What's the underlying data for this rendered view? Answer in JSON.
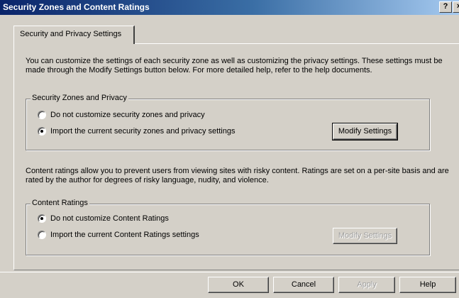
{
  "window": {
    "title": "Security Zones and Content Ratings",
    "help_label": "?",
    "close_label": "×"
  },
  "tab": {
    "label": "Security and Privacy Settings"
  },
  "intro_text": "You can customize the settings of each security zone as well as customizing the privacy settings. These settings must be made through the Modify Settings button below. For more detailed help, refer to the help documents.",
  "security_group": {
    "legend": "Security Zones and Privacy",
    "options": [
      {
        "label": "Do not customize security zones and privacy",
        "selected": false
      },
      {
        "label": "Import the current security zones and privacy settings",
        "selected": true
      }
    ],
    "modify_label": "Modify Settings"
  },
  "ratings_text": "Content ratings allow you to prevent users from viewing sites with risky content. Ratings are set on a per-site basis and are rated by the author for degrees of risky language, nudity, and violence.",
  "ratings_group": {
    "legend": "Content Ratings",
    "options": [
      {
        "label": "Do not customize Content Ratings",
        "selected": true
      },
      {
        "label": "Import the current Content Ratings settings",
        "selected": false
      }
    ],
    "modify_label": "Modify Settings"
  },
  "footer": {
    "ok_label": "OK",
    "cancel_label": "Cancel",
    "apply_label": "Apply",
    "help_label": "Help"
  }
}
